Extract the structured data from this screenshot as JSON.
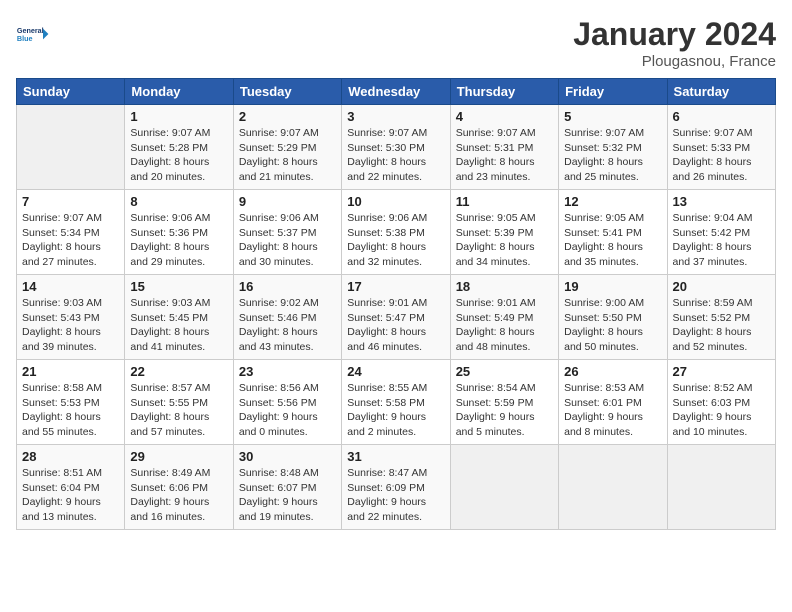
{
  "header": {
    "logo_line1": "General",
    "logo_line2": "Blue",
    "month": "January 2024",
    "location": "Plougasnou, France"
  },
  "weekdays": [
    "Sunday",
    "Monday",
    "Tuesday",
    "Wednesday",
    "Thursday",
    "Friday",
    "Saturday"
  ],
  "weeks": [
    [
      {
        "day": "",
        "info": ""
      },
      {
        "day": "1",
        "info": "Sunrise: 9:07 AM\nSunset: 5:28 PM\nDaylight: 8 hours\nand 20 minutes."
      },
      {
        "day": "2",
        "info": "Sunrise: 9:07 AM\nSunset: 5:29 PM\nDaylight: 8 hours\nand 21 minutes."
      },
      {
        "day": "3",
        "info": "Sunrise: 9:07 AM\nSunset: 5:30 PM\nDaylight: 8 hours\nand 22 minutes."
      },
      {
        "day": "4",
        "info": "Sunrise: 9:07 AM\nSunset: 5:31 PM\nDaylight: 8 hours\nand 23 minutes."
      },
      {
        "day": "5",
        "info": "Sunrise: 9:07 AM\nSunset: 5:32 PM\nDaylight: 8 hours\nand 25 minutes."
      },
      {
        "day": "6",
        "info": "Sunrise: 9:07 AM\nSunset: 5:33 PM\nDaylight: 8 hours\nand 26 minutes."
      }
    ],
    [
      {
        "day": "7",
        "info": "Sunrise: 9:07 AM\nSunset: 5:34 PM\nDaylight: 8 hours\nand 27 minutes."
      },
      {
        "day": "8",
        "info": "Sunrise: 9:06 AM\nSunset: 5:36 PM\nDaylight: 8 hours\nand 29 minutes."
      },
      {
        "day": "9",
        "info": "Sunrise: 9:06 AM\nSunset: 5:37 PM\nDaylight: 8 hours\nand 30 minutes."
      },
      {
        "day": "10",
        "info": "Sunrise: 9:06 AM\nSunset: 5:38 PM\nDaylight: 8 hours\nand 32 minutes."
      },
      {
        "day": "11",
        "info": "Sunrise: 9:05 AM\nSunset: 5:39 PM\nDaylight: 8 hours\nand 34 minutes."
      },
      {
        "day": "12",
        "info": "Sunrise: 9:05 AM\nSunset: 5:41 PM\nDaylight: 8 hours\nand 35 minutes."
      },
      {
        "day": "13",
        "info": "Sunrise: 9:04 AM\nSunset: 5:42 PM\nDaylight: 8 hours\nand 37 minutes."
      }
    ],
    [
      {
        "day": "14",
        "info": "Sunrise: 9:03 AM\nSunset: 5:43 PM\nDaylight: 8 hours\nand 39 minutes."
      },
      {
        "day": "15",
        "info": "Sunrise: 9:03 AM\nSunset: 5:45 PM\nDaylight: 8 hours\nand 41 minutes."
      },
      {
        "day": "16",
        "info": "Sunrise: 9:02 AM\nSunset: 5:46 PM\nDaylight: 8 hours\nand 43 minutes."
      },
      {
        "day": "17",
        "info": "Sunrise: 9:01 AM\nSunset: 5:47 PM\nDaylight: 8 hours\nand 46 minutes."
      },
      {
        "day": "18",
        "info": "Sunrise: 9:01 AM\nSunset: 5:49 PM\nDaylight: 8 hours\nand 48 minutes."
      },
      {
        "day": "19",
        "info": "Sunrise: 9:00 AM\nSunset: 5:50 PM\nDaylight: 8 hours\nand 50 minutes."
      },
      {
        "day": "20",
        "info": "Sunrise: 8:59 AM\nSunset: 5:52 PM\nDaylight: 8 hours\nand 52 minutes."
      }
    ],
    [
      {
        "day": "21",
        "info": "Sunrise: 8:58 AM\nSunset: 5:53 PM\nDaylight: 8 hours\nand 55 minutes."
      },
      {
        "day": "22",
        "info": "Sunrise: 8:57 AM\nSunset: 5:55 PM\nDaylight: 8 hours\nand 57 minutes."
      },
      {
        "day": "23",
        "info": "Sunrise: 8:56 AM\nSunset: 5:56 PM\nDaylight: 9 hours\nand 0 minutes."
      },
      {
        "day": "24",
        "info": "Sunrise: 8:55 AM\nSunset: 5:58 PM\nDaylight: 9 hours\nand 2 minutes."
      },
      {
        "day": "25",
        "info": "Sunrise: 8:54 AM\nSunset: 5:59 PM\nDaylight: 9 hours\nand 5 minutes."
      },
      {
        "day": "26",
        "info": "Sunrise: 8:53 AM\nSunset: 6:01 PM\nDaylight: 9 hours\nand 8 minutes."
      },
      {
        "day": "27",
        "info": "Sunrise: 8:52 AM\nSunset: 6:03 PM\nDaylight: 9 hours\nand 10 minutes."
      }
    ],
    [
      {
        "day": "28",
        "info": "Sunrise: 8:51 AM\nSunset: 6:04 PM\nDaylight: 9 hours\nand 13 minutes."
      },
      {
        "day": "29",
        "info": "Sunrise: 8:49 AM\nSunset: 6:06 PM\nDaylight: 9 hours\nand 16 minutes."
      },
      {
        "day": "30",
        "info": "Sunrise: 8:48 AM\nSunset: 6:07 PM\nDaylight: 9 hours\nand 19 minutes."
      },
      {
        "day": "31",
        "info": "Sunrise: 8:47 AM\nSunset: 6:09 PM\nDaylight: 9 hours\nand 22 minutes."
      },
      {
        "day": "",
        "info": ""
      },
      {
        "day": "",
        "info": ""
      },
      {
        "day": "",
        "info": ""
      }
    ]
  ]
}
